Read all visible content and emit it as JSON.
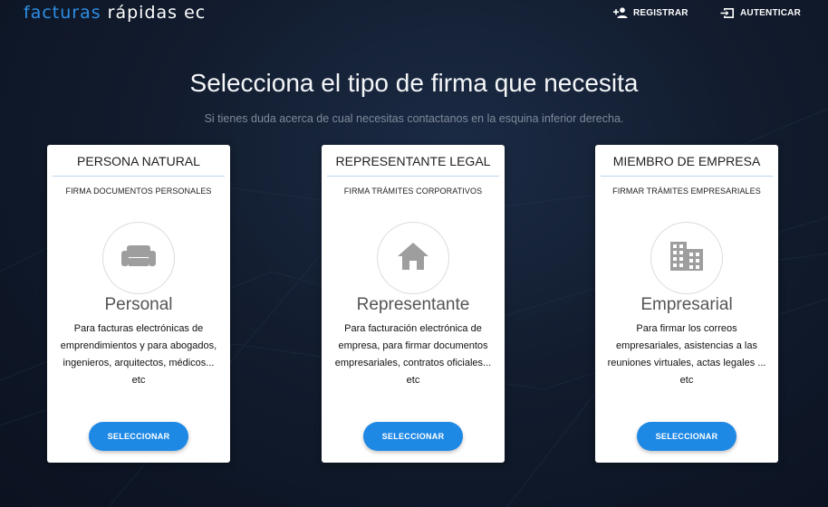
{
  "header": {
    "logo_part1": "facturas",
    "logo_part2": " rápidas ec",
    "register_label": "REGISTRAR",
    "login_label": "AUTENTICAR"
  },
  "hero": {
    "title": "Selecciona el tipo de firma que necesita",
    "subtitle": "Si tienes duda acerca de cual necesitas contactanos en la esquina inferior derecha."
  },
  "cards": [
    {
      "title": "PERSONA NATURAL",
      "subtitle": "FIRMA DOCUMENTOS PERSONALES",
      "icon": "sofa-icon",
      "type": "Personal",
      "description": "Para facturas electrónicas de emprendimientos y para abogados, ingenieros, arquitectos, médicos... etc",
      "button": "SELECCIONAR"
    },
    {
      "title": "REPRESENTANTE LEGAL",
      "subtitle": "FIRMA TRÁMITES CORPORATIVOS",
      "icon": "home-icon",
      "type": "Representante",
      "description": "Para facturación electrónica de empresa, para firmar documentos empresariales, contratos oficiales... etc",
      "button": "SELECCIONAR"
    },
    {
      "title": "MIEMBRO DE EMPRESA",
      "subtitle": "FIRMAR TRÁMITES EMPRESARIALES",
      "icon": "building-icon",
      "type": "Empresarial",
      "description": "Para firmar los correos empresariales, asistencias a las reuniones virtuales, actas legales ... etc",
      "button": "SELECCIONAR"
    }
  ],
  "colors": {
    "accent": "#1e88e5",
    "logo_blue": "#2d8fe6",
    "background": "#121c2e",
    "icon_gray": "#9e9e9e"
  }
}
